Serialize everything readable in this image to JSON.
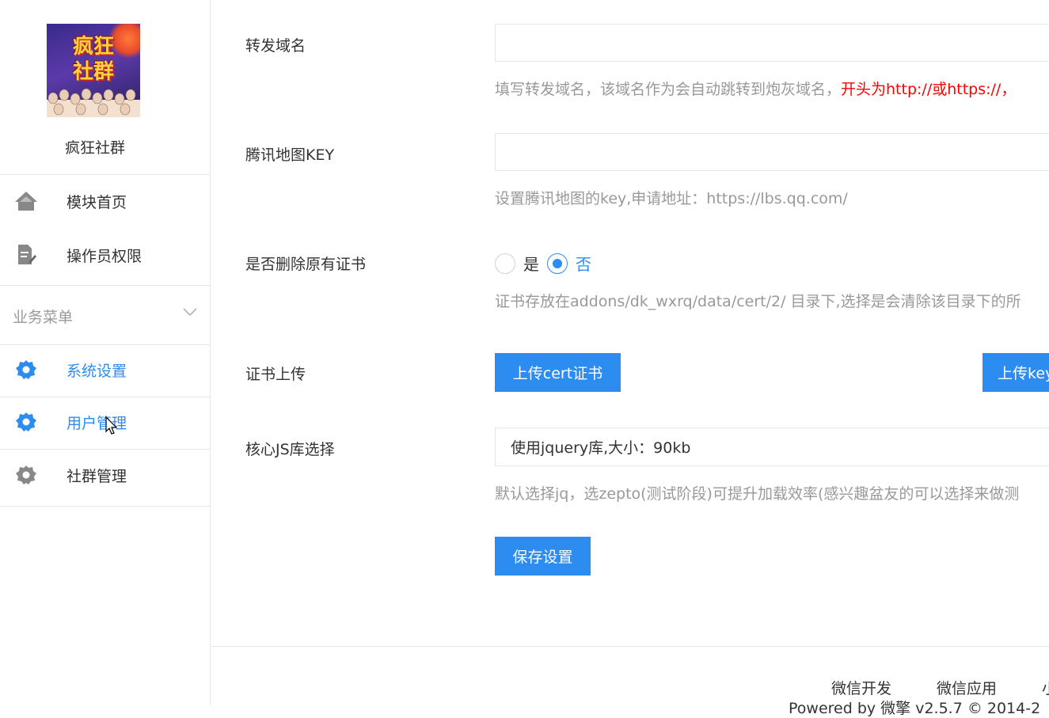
{
  "sidebar": {
    "logo_text_line1": "疯狂",
    "logo_text_line2": "社群",
    "site_name": "疯狂社群",
    "top_items": [
      {
        "label": "模块首页",
        "icon": "home-icon"
      },
      {
        "label": "操作员权限",
        "icon": "document-edit-icon"
      }
    ],
    "section_title": "业务菜单",
    "menu_items": [
      {
        "label": "系统设置",
        "icon": "gear-icon",
        "active": true
      },
      {
        "label": "用户管理",
        "icon": "gear-icon",
        "active": true
      },
      {
        "label": "社群管理",
        "icon": "gear-icon",
        "active": false
      }
    ]
  },
  "form": {
    "forward_domain": {
      "label": "转发域名",
      "value": "",
      "help_gray": "填写转发域名，该域名作为会自动跳转到炮灰域名，",
      "help_red": "开头为http://或https://，"
    },
    "tencent_map_key": {
      "label": "腾讯地图KEY",
      "value": "",
      "help": "设置腾讯地图的key,申请地址：https://lbs.qq.com/"
    },
    "delete_cert": {
      "label": "是否删除原有证书",
      "options": [
        "是",
        "否"
      ],
      "selected": "否",
      "help": "证书存放在addons/dk_wxrq/data/cert/2/ 目录下,选择是会清除该目录下的所"
    },
    "cert_upload": {
      "label": "证书上传",
      "upload_cert_button": "上传cert证书",
      "upload_key_button": "上传key"
    },
    "js_lib": {
      "label": "核心JS库选择",
      "selected": "使用jquery库,大小：90kb",
      "help": "默认选择jq，选zepto(测试阶段)可提升加载效率(感兴趣盆友的可以选择来做测"
    },
    "save_button": "保存设置"
  },
  "footer": {
    "links": [
      "微信开发",
      "微信应用",
      "小"
    ],
    "powered": "Powered by 微擎 v2.5.7 © 2014-2"
  },
  "colors": {
    "accent": "#2d8cf0",
    "warning_red": "#ff0000",
    "help_gray": "#999999"
  }
}
